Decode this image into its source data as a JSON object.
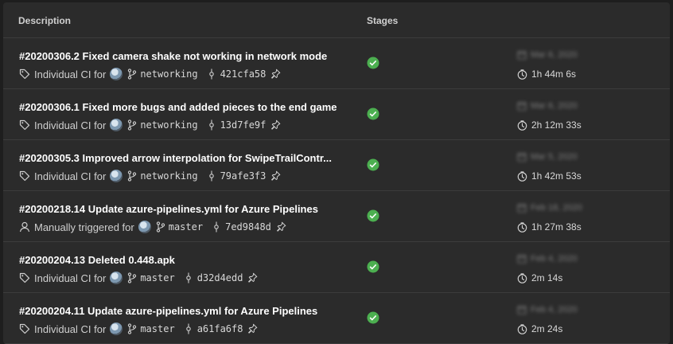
{
  "header": {
    "description": "Description",
    "stages": "Stages"
  },
  "runs": [
    {
      "title": "#20200306.2 Fixed camera shake not working in network mode",
      "trigger": "Individual CI for",
      "trigger_icon": "tag-icon",
      "branch": "networking",
      "commit": "421cfa58",
      "status": "succeeded",
      "date": "Mar 6, 2020",
      "duration": "1h 44m 6s"
    },
    {
      "title": "#20200306.1 Fixed more bugs and added pieces to the end game",
      "trigger": "Individual CI for",
      "trigger_icon": "tag-icon",
      "branch": "networking",
      "commit": "13d7fe9f",
      "status": "succeeded",
      "date": "Mar 6, 2020",
      "duration": "2h 12m 33s"
    },
    {
      "title": "#20200305.3 Improved arrow interpolation for SwipeTrailContr...",
      "trigger": "Individual CI for",
      "trigger_icon": "tag-icon",
      "branch": "networking",
      "commit": "79afe3f3",
      "status": "succeeded",
      "date": "Mar 5, 2020",
      "duration": "1h 42m 53s"
    },
    {
      "title": "#20200218.14 Update azure-pipelines.yml for Azure Pipelines",
      "trigger": "Manually triggered for",
      "trigger_icon": "person-icon",
      "branch": "master",
      "commit": "7ed9848d",
      "status": "succeeded",
      "date": "Feb 18, 2020",
      "duration": "1h 27m 38s"
    },
    {
      "title": "#20200204.13 Deleted 0.448.apk",
      "trigger": "Individual CI for",
      "trigger_icon": "tag-icon",
      "branch": "master",
      "commit": "d32d4edd",
      "status": "succeeded",
      "date": "Feb 4, 2020",
      "duration": "2m 14s"
    },
    {
      "title": "#20200204.11 Update azure-pipelines.yml for Azure Pipelines",
      "trigger": "Individual CI for",
      "trigger_icon": "tag-icon",
      "branch": "master",
      "commit": "a61fa6f8",
      "status": "succeeded",
      "date": "Feb 4, 2020",
      "duration": "2m 24s"
    }
  ],
  "colors": {
    "success": "#4caf50",
    "background": "#2b2b2b"
  }
}
